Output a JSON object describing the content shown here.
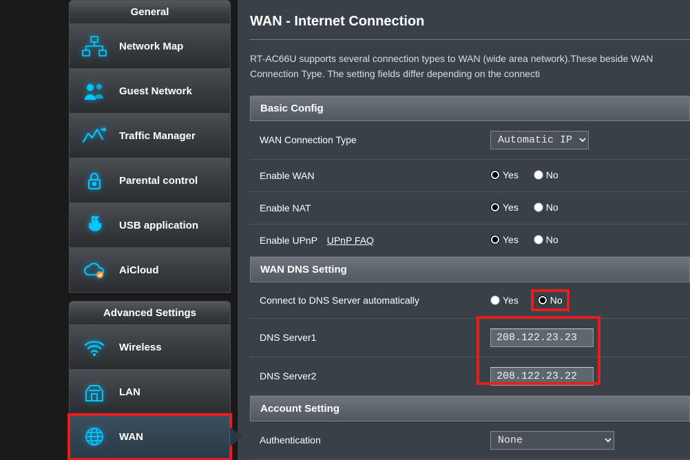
{
  "sidebar": {
    "general_header": "General",
    "advanced_header": "Advanced Settings",
    "general_items": [
      {
        "label": "Network Map",
        "icon": "network-map-icon",
        "name": "sidebar-item-network-map"
      },
      {
        "label": "Guest Network",
        "icon": "guest-network-icon",
        "name": "sidebar-item-guest-network"
      },
      {
        "label": "Traffic Manager",
        "icon": "traffic-manager-icon",
        "name": "sidebar-item-traffic-manager"
      },
      {
        "label": "Parental control",
        "icon": "parental-control-icon",
        "name": "sidebar-item-parental-control"
      },
      {
        "label": "USB application",
        "icon": "usb-application-icon",
        "name": "sidebar-item-usb-application"
      },
      {
        "label": "AiCloud",
        "icon": "aicloud-icon",
        "name": "sidebar-item-aicloud"
      }
    ],
    "advanced_items": [
      {
        "label": "Wireless",
        "icon": "wireless-icon",
        "name": "sidebar-item-wireless"
      },
      {
        "label": "LAN",
        "icon": "lan-icon",
        "name": "sidebar-item-lan"
      },
      {
        "label": "WAN",
        "icon": "wan-icon",
        "name": "sidebar-item-wan",
        "selected": true
      }
    ]
  },
  "page": {
    "title": "WAN - Internet Connection",
    "description": "RT-AC66U supports several connection types to WAN (wide area network).These beside WAN Connection Type. The setting fields differ depending on the connecti"
  },
  "sections": {
    "basic": {
      "header": "Basic Config",
      "rows": {
        "conn_type": {
          "label": "WAN Connection Type",
          "value": "Automatic IP"
        },
        "enable_wan": {
          "label": "Enable WAN",
          "yes": "Yes",
          "no": "No"
        },
        "enable_nat": {
          "label": "Enable NAT",
          "yes": "Yes",
          "no": "No"
        },
        "enable_upnp": {
          "label": "Enable UPnP",
          "faq": "UPnP FAQ",
          "yes": "Yes",
          "no": "No"
        }
      }
    },
    "dns": {
      "header": "WAN DNS Setting",
      "rows": {
        "auto": {
          "label": "Connect to DNS Server automatically",
          "yes": "Yes",
          "no": "No"
        },
        "dns1": {
          "label": "DNS Server1",
          "value": "208.122.23.23"
        },
        "dns2": {
          "label": "DNS Server2",
          "value": "208.122.23.22"
        }
      }
    },
    "account": {
      "header": "Account Setting",
      "rows": {
        "auth": {
          "label": "Authentication",
          "value": "None"
        }
      }
    }
  }
}
